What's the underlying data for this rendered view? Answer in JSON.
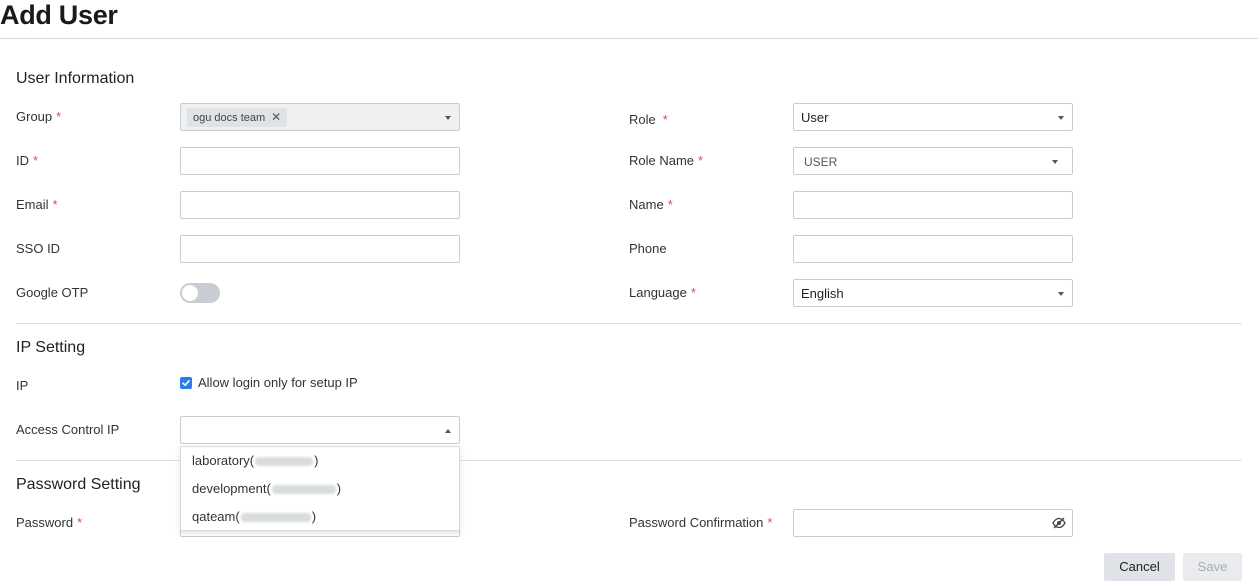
{
  "page": {
    "title": "Add User"
  },
  "user_info": {
    "section_title": "User Information",
    "group": {
      "label": "Group",
      "required": "*",
      "tag": "ogu docs team",
      "tag_remove": "✕"
    },
    "id": {
      "label": "ID",
      "required": "*",
      "value": ""
    },
    "email": {
      "label": "Email",
      "required": "*",
      "value": ""
    },
    "sso_id": {
      "label": "SSO ID",
      "value": ""
    },
    "google_otp": {
      "label": "Google OTP",
      "enabled": false
    },
    "role": {
      "label": "Role",
      "required": "*",
      "value": "User"
    },
    "role_name": {
      "label": "Role Name",
      "required": "*",
      "value": "USER"
    },
    "name": {
      "label": "Name",
      "required": "*",
      "value": ""
    },
    "phone": {
      "label": "Phone",
      "value": ""
    },
    "language": {
      "label": "Language",
      "required": "*",
      "value": "English"
    }
  },
  "ip_setting": {
    "section_title": "IP Setting",
    "ip_label": "IP",
    "allow_login_label": "Allow login only for setup IP",
    "allow_login_checked": true,
    "access_control_label": "Access Control IP",
    "access_control_value": "",
    "options": [
      {
        "name": "laboratory(",
        "close": ")"
      },
      {
        "name": "development(",
        "close": ")"
      },
      {
        "name": "qateam(",
        "close": ")"
      }
    ]
  },
  "password_setting": {
    "section_title": "Password Setting",
    "password": {
      "label": "Password",
      "required": "*"
    },
    "confirmation": {
      "label": "Password Confirmation",
      "required": "*"
    }
  },
  "actions": {
    "cancel": "Cancel",
    "save": "Save"
  },
  "colors": {
    "accent": "#2b7de9",
    "required": "#e04848"
  }
}
